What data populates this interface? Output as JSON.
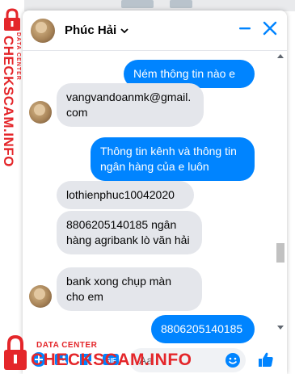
{
  "header": {
    "contact_name": "Phúc Hải"
  },
  "messages": [
    {
      "direction": "out",
      "text": "Ném thông tin nào e"
    },
    {
      "direction": "in",
      "text": "vangvandoanmk@gmail.com",
      "avatar": true
    },
    {
      "direction": "out",
      "text": "Thông tin kênh và thông tin ngân hàng của e luôn"
    },
    {
      "direction": "in",
      "text": "lothienphuc10042020"
    },
    {
      "direction": "in",
      "text": "8806205140185 ngân hàng agribank lò văn hải"
    },
    {
      "direction": "in",
      "text": "bank xong chụp màn cho em",
      "avatar": true
    },
    {
      "direction": "out",
      "text": "8806205140185"
    }
  ],
  "composer": {
    "placeholder": "Aa"
  },
  "watermark": {
    "main": "CHECKSCAM.INFO",
    "small": "DATA CENTER"
  },
  "colors": {
    "messenger_blue": "#0084ff",
    "incoming_bubble": "#e4e6eb",
    "watermark_red": "#e4262a"
  },
  "icons": [
    "chevron-down-icon",
    "minimize-icon",
    "close-icon",
    "add-icon",
    "photo-icon",
    "sticker-icon",
    "gif-icon",
    "emoji-icon",
    "thumbs-up-icon"
  ]
}
